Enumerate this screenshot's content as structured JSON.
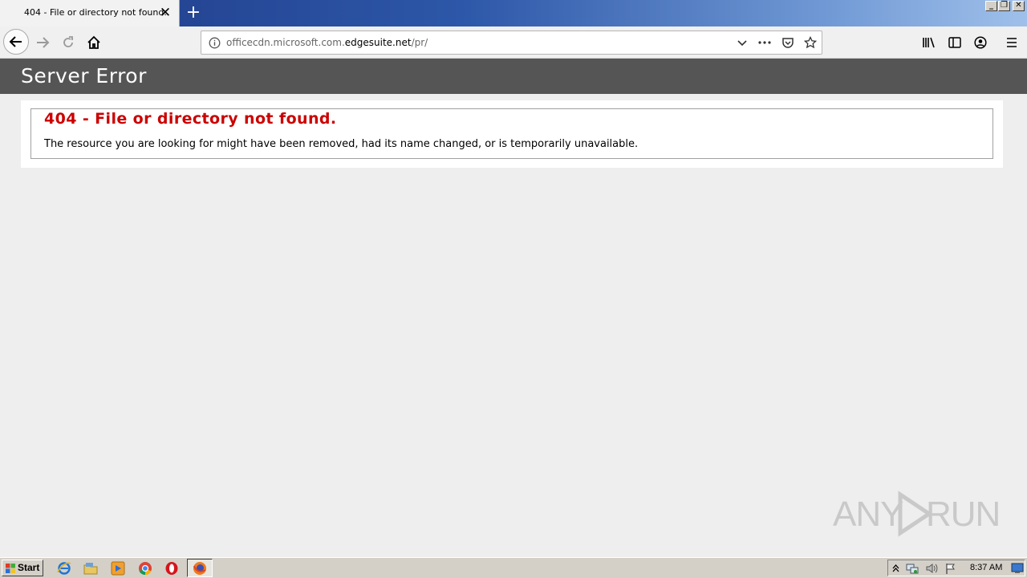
{
  "browser": {
    "tab": {
      "title": "404 - File or directory not found.",
      "close_glyph": "✕"
    },
    "new_tab_glyph": "+",
    "window_buttons": {
      "minimize": "_",
      "restore": "❐",
      "close": "✕"
    },
    "url": {
      "prefix": "officecdn.microsoft.com.",
      "domain": "edgesuite.net",
      "path": "/pr/"
    }
  },
  "page": {
    "header_title": "Server Error",
    "error_title": "404 - File or directory not found.",
    "error_message": "The resource you are looking for might have been removed, had its name changed, or is temporarily unavailable."
  },
  "watermark": {
    "left": "ANY",
    "right": "RUN"
  },
  "taskbar": {
    "start_label": "Start",
    "clock": "8:37 AM",
    "pinned": [
      "internet-explorer-icon",
      "folder-icon",
      "media-player-icon",
      "chrome-icon",
      "opera-icon",
      "firefox-icon"
    ]
  },
  "colors": {
    "header_bg": "#555555",
    "error_red": "#cc0000",
    "page_bg": "#eeeeee",
    "taskbar_bg": "#d4d0c8"
  }
}
